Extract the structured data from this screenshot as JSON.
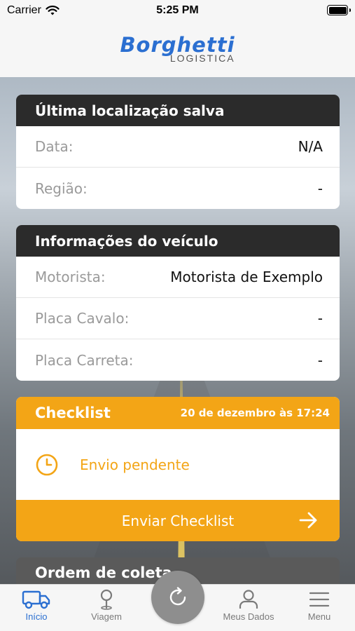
{
  "status_bar": {
    "carrier": "Carrier",
    "time": "5:25 PM"
  },
  "brand": {
    "name": "Borghetti",
    "subtitle": "LOGISTICA",
    "color": "#2b6fd1"
  },
  "location_card": {
    "title": "Última localização salva",
    "rows": [
      {
        "label": "Data:",
        "value": "N/A"
      },
      {
        "label": "Região:",
        "value": "-"
      }
    ]
  },
  "vehicle_card": {
    "title": "Informações do veículo",
    "rows": [
      {
        "label": "Motorista:",
        "value": "Motorista de Exemplo"
      },
      {
        "label": "Placa Cavalo:",
        "value": "-"
      },
      {
        "label": "Placa Carreta:",
        "value": "-"
      }
    ]
  },
  "checklist_card": {
    "title": "Checklist",
    "date": "20 de dezembro às 17:24",
    "status": "Envio pendente",
    "button": "Enviar Checklist",
    "accent": "#f3a516"
  },
  "order_card": {
    "title": "Ordem de coleta"
  },
  "tabs": [
    {
      "label": "Início",
      "icon": "truck-icon",
      "active": true
    },
    {
      "label": "Viagem",
      "icon": "map-pin-icon",
      "active": false
    },
    {
      "label": "Meus Dados",
      "icon": "user-icon",
      "active": false
    },
    {
      "label": "Menu",
      "icon": "menu-icon",
      "active": false
    }
  ],
  "fab": {
    "icon": "refresh-icon"
  }
}
